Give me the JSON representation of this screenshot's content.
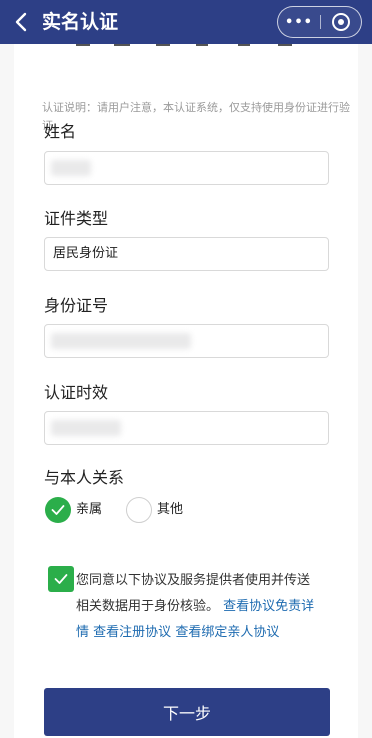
{
  "header": {
    "title": "实名认证",
    "more_label": "•••",
    "back_icon": "chevron-left-icon",
    "close_icon": "target-close-icon",
    "bg_color": "#2d3f86"
  },
  "notice": {
    "text": "认证说明：请用户注意，本认证系统，仅支持使用身份证进行验证。"
  },
  "form": {
    "name": {
      "label": "姓名",
      "value": ""
    },
    "id_type": {
      "label": "证件类型",
      "value": "居民身份证"
    },
    "id_number": {
      "label": "身份证号",
      "value": ""
    },
    "validity": {
      "label": "认证时效",
      "value": ""
    }
  },
  "relation": {
    "label": "与本人关系",
    "options": [
      {
        "label": "亲属",
        "selected": true
      },
      {
        "label": "其他",
        "selected": false
      }
    ],
    "accent_color": "#2bae4a"
  },
  "agreement": {
    "checked": true,
    "text": "您同意以下协议及服务提供者使用并传送相关数据用于身份核验。",
    "link_disclaimer": "查看协议免责详情",
    "link_register": "查看注册协议",
    "link_bind": "查看绑定亲人协议",
    "link_color": "#1e6bb0"
  },
  "submit": {
    "label": "下一步",
    "bg_color": "#2d3f86"
  }
}
